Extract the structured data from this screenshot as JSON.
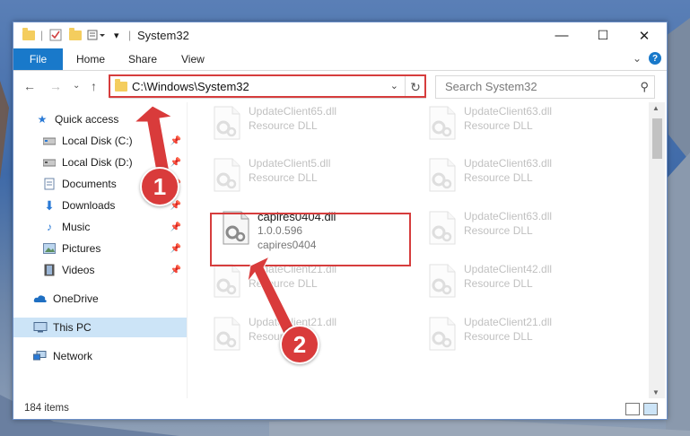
{
  "window": {
    "title": "System32",
    "controls": {
      "minimize": "—",
      "maximize": "☐",
      "close": "✕"
    }
  },
  "ribbon": {
    "tabs": [
      "File",
      "Home",
      "Share",
      "View"
    ],
    "help": "?"
  },
  "address_bar": {
    "path": "C:\\Windows\\System32",
    "search_placeholder": "Search System32"
  },
  "sidebar": {
    "items": [
      {
        "label": "Quick access",
        "icon": "star-icon"
      },
      {
        "label": "Local Disk (C:)",
        "icon": "drive-icon",
        "pinned": true
      },
      {
        "label": "Local Disk (D:)",
        "icon": "drive-icon",
        "pinned": true
      },
      {
        "label": "Documents",
        "icon": "documents-icon",
        "pinned": true
      },
      {
        "label": "Downloads",
        "icon": "download-icon",
        "pinned": true
      },
      {
        "label": "Music",
        "icon": "music-icon",
        "pinned": true
      },
      {
        "label": "Pictures",
        "icon": "pictures-icon",
        "pinned": true
      },
      {
        "label": "Videos",
        "icon": "videos-icon",
        "pinned": true
      },
      {
        "label": "OneDrive",
        "icon": "cloud-icon"
      },
      {
        "label": "This PC",
        "icon": "pc-icon",
        "selected": true
      },
      {
        "label": "Network",
        "icon": "network-icon"
      }
    ]
  },
  "files": [
    {
      "name": "UpdateClient65.dll",
      "type": "Resource DLL"
    },
    {
      "name": "UpdateClient63.dll",
      "type": "Resource DLL"
    },
    {
      "name": "UpdateClient5.dll",
      "type": "Resource DLL"
    },
    {
      "name": "UpdateClient63.dll",
      "type": "Resource DLL"
    },
    {
      "name": "capires0404.dll",
      "version": "1.0.0.596",
      "description": "capires0404"
    },
    {
      "name": "UpdateClient63.dll",
      "type": "Resource DLL"
    },
    {
      "name": "UpdateClient21.dll",
      "type": "Resource DLL"
    },
    {
      "name": "UpdateClient42.dll",
      "type": "Resource DLL"
    },
    {
      "name": "UpdateClient21.dll",
      "type": "Resource DLL"
    },
    {
      "name": "UpdateClient21.dll",
      "type": "Resource DLL"
    }
  ],
  "status": {
    "item_count": "184 items"
  },
  "callouts": [
    "1",
    "2"
  ],
  "colors": {
    "accent": "#1979ca",
    "highlight": "#d63d3d"
  }
}
